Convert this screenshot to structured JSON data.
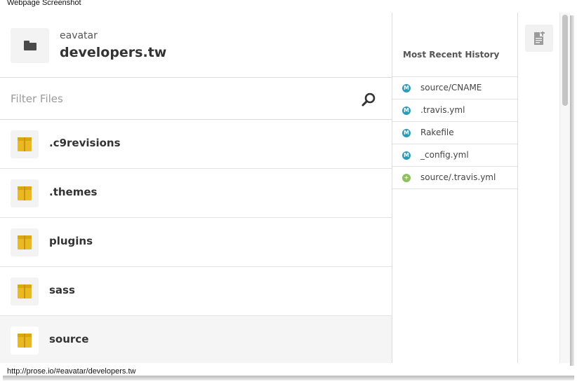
{
  "caption": "Webpage Screenshot",
  "repo": {
    "owner": "eavatar",
    "name": "developers.tw",
    "icon": "folder-icon"
  },
  "filter": {
    "placeholder": "Filter Files",
    "value": "",
    "icon": "search-icon"
  },
  "files": [
    {
      "name": ".c9revisions",
      "icon": "box-icon",
      "active": false
    },
    {
      "name": ".themes",
      "icon": "box-icon",
      "active": false
    },
    {
      "name": "plugins",
      "icon": "box-icon",
      "active": false
    },
    {
      "name": "sass",
      "icon": "box-icon",
      "active": false
    },
    {
      "name": "source",
      "icon": "box-icon",
      "active": true
    }
  ],
  "history": {
    "title": "Most Recent History",
    "items": [
      {
        "name": "source/CNAME",
        "status": "modified",
        "status_glyph": "M"
      },
      {
        "name": ".travis.yml",
        "status": "modified",
        "status_glyph": "M"
      },
      {
        "name": "Rakefile",
        "status": "modified",
        "status_glyph": "M"
      },
      {
        "name": "_config.yml",
        "status": "modified",
        "status_glyph": "M"
      },
      {
        "name": "source/.travis.yml",
        "status": "added",
        "status_glyph": "+"
      }
    ]
  },
  "toolbar": {
    "new_file_icon": "new-file-icon"
  },
  "status_bar": {
    "url": "http://prose.io/#eavatar/developers.tw"
  },
  "colors": {
    "folder_box": "#e8b923",
    "modified": "#2a9bb8",
    "added": "#8cc15c",
    "active_row": "#f5f5f5"
  }
}
